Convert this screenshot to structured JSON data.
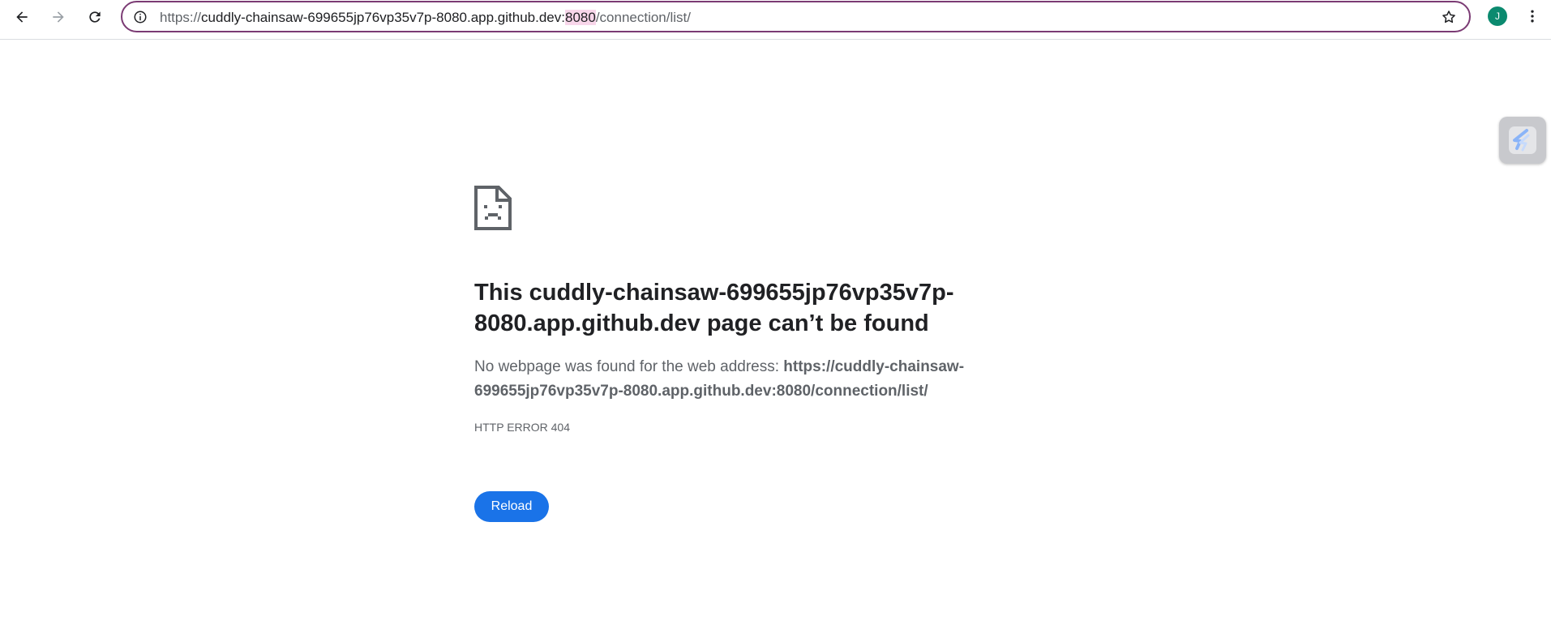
{
  "browser": {
    "url": {
      "scheme": "https://",
      "host": "cuddly-chainsaw-699655jp76vp35v7p-8080.app.github.dev:",
      "port": "8080",
      "path": "/connection/list/"
    },
    "profile_initial": "J",
    "icons": {
      "back": "arrow-left-icon",
      "forward": "arrow-right-icon",
      "reload": "reload-icon",
      "site_info": "info-icon",
      "bookmark": "star-icon",
      "menu": "kebab-menu-icon",
      "extension": "extension-icon"
    }
  },
  "error_page": {
    "title": "This cuddly-chainsaw-699655jp76vp35v7p-8080.app.github.dev page can’t be found",
    "description_prefix": "No webpage was found for the web address: ",
    "description_url": "https://cuddly-chainsaw-699655jp76vp35v7p-8080.app.github.dev:8080/connection/list/",
    "error_code": "HTTP ERROR 404",
    "reload_label": "Reload",
    "icon": "sad-page-icon"
  },
  "colors": {
    "accent": "#1a73e8",
    "omnibox_border": "#7b3b74",
    "avatar": "#0b8a6f",
    "port_highlight": "#f8d6ea"
  }
}
